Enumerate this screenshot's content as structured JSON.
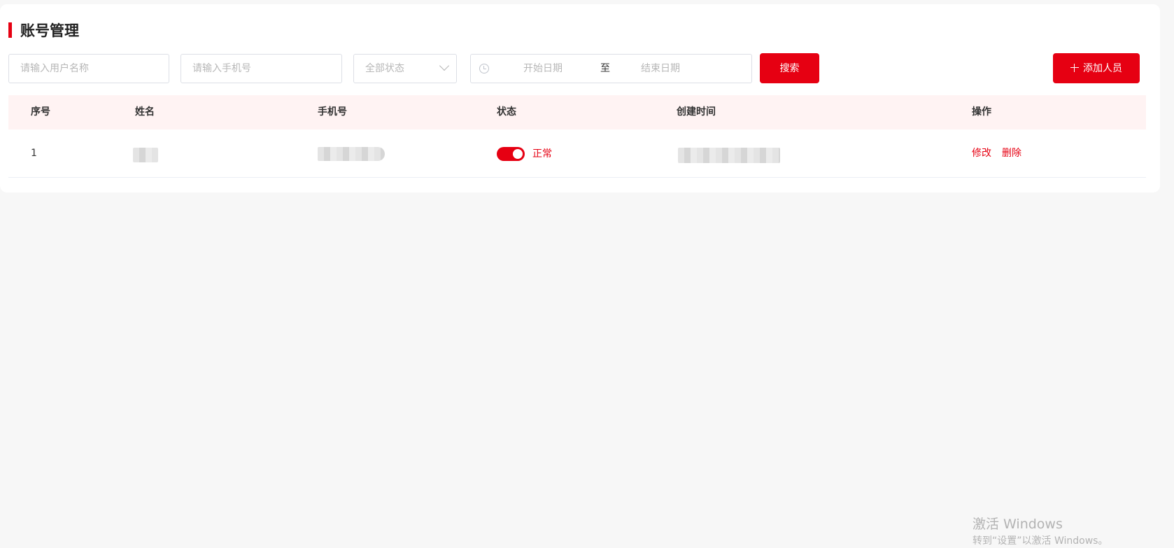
{
  "page": {
    "title": "账号管理"
  },
  "filters": {
    "username_placeholder": "请输入用户名称",
    "phone_placeholder": "请输入手机号",
    "status_select_value": "全部状态",
    "date_start_placeholder": "开始日期",
    "date_separator": "至",
    "date_end_placeholder": "结束日期",
    "search_label": "搜索",
    "add_label": "添加人员"
  },
  "table": {
    "columns": [
      "序号",
      "姓名",
      "手机号",
      "状态",
      "创建时间",
      "操作"
    ],
    "rows": [
      {
        "index": "1",
        "status_enabled": true,
        "status_label": "正常",
        "edit_label": "修改",
        "delete_label": "删除"
      }
    ]
  },
  "watermark": {
    "title": "激活 Windows",
    "subtitle": "转到“设置”以激活 Windows。"
  },
  "colors": {
    "accent": "#e60012",
    "header_bg": "#fff3f3",
    "page_bg": "#f7f7f7"
  }
}
